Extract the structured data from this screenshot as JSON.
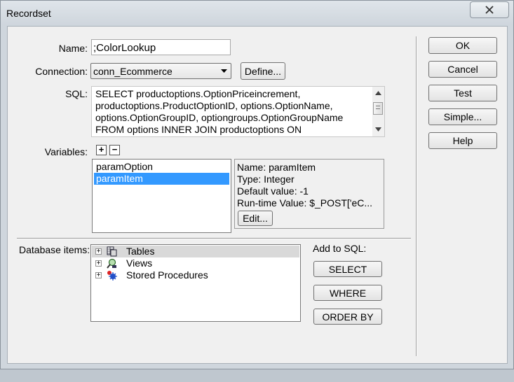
{
  "window": {
    "title": "Recordset"
  },
  "form": {
    "name_label": "Name:",
    "name_value": ";ColorLookup",
    "connection_label": "Connection:",
    "connection_value": "conn_Ecommerce",
    "define_label": "Define...",
    "sql_label": "SQL:",
    "sql_lines": [
      "SELECT productoptions.OptionPriceincrement,",
      "productoptions.ProductOptionID, options.OptionName,",
      "options.OptionGroupID, optiongroups.OptionGroupName",
      "FROM options INNER JOIN productoptions ON"
    ],
    "variables_label": "Variables:",
    "add_variable": "+",
    "remove_variable": "−"
  },
  "variables": {
    "items": [
      "paramOption",
      "paramItem"
    ],
    "selected_index": 1,
    "details": {
      "name": "Name: paramItem",
      "type": "Type: Integer",
      "default": "Default value: -1",
      "runtime": "Run-time Value: $_POST['eC..."
    },
    "edit_label": "Edit..."
  },
  "database": {
    "label": "Database items:",
    "tree": [
      {
        "label": "Tables",
        "icon": "table-icon",
        "selected": true
      },
      {
        "label": "Views",
        "icon": "views-icon",
        "selected": false
      },
      {
        "label": "Stored Procedures",
        "icon": "stored-procedures-icon",
        "selected": false
      }
    ],
    "add_to_sql_label": "Add to SQL:",
    "select_label": "SELECT",
    "where_label": "WHERE",
    "orderby_label": "ORDER BY"
  },
  "side_buttons": {
    "ok": "OK",
    "cancel": "Cancel",
    "test": "Test",
    "simple": "Simple...",
    "help": "Help"
  },
  "colors": {
    "selection": "#3399ff",
    "tree_selection": "#d9d9d9"
  }
}
